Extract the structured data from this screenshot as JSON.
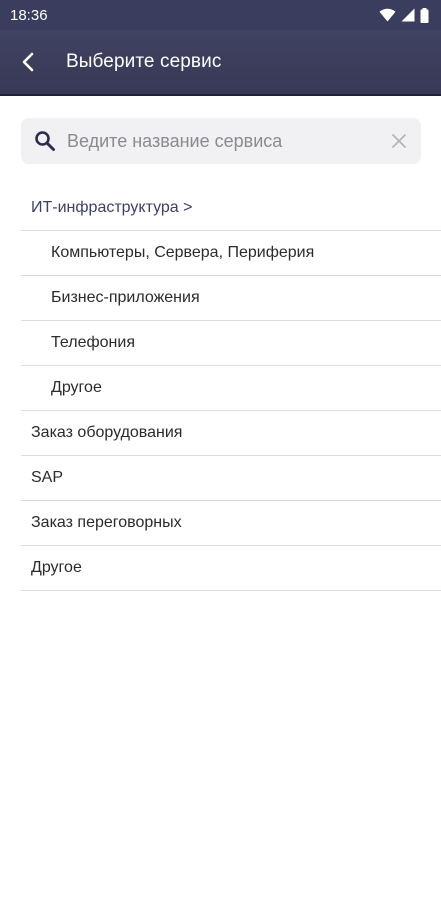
{
  "status_bar": {
    "time": "18:36"
  },
  "header": {
    "title": "Выберите сервис"
  },
  "search": {
    "placeholder": "Ведите название сервиса"
  },
  "list": {
    "category": "ИТ-инфраструктура >",
    "sub_items": [
      "Компьютеры, Сервера, Периферия",
      "Бизнес-приложения",
      "Телефония",
      "Другое"
    ],
    "items": [
      "Заказ оборудования",
      "SAP",
      "Заказ переговорных",
      "Другое"
    ]
  },
  "colors": {
    "header_bg": "#3b3d5e",
    "category_text": "#3d4068",
    "search_bg": "#f1f1f3",
    "divider": "#dcdcdf"
  }
}
